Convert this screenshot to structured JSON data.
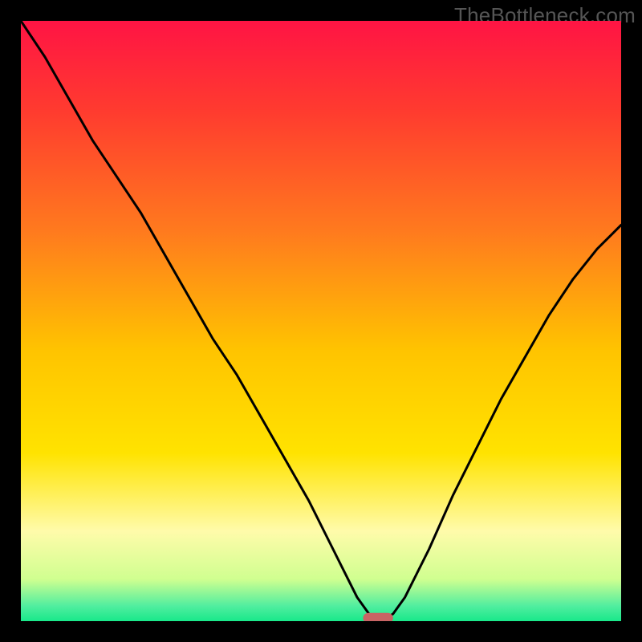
{
  "watermark": "TheBottleneck.com",
  "colors": {
    "frame": "#000000",
    "curve": "#000000",
    "marker": "#c86464",
    "gradient_stops": [
      {
        "offset": 0.0,
        "color": "#ff1444"
      },
      {
        "offset": 0.15,
        "color": "#ff3b2f"
      },
      {
        "offset": 0.35,
        "color": "#ff7a1e"
      },
      {
        "offset": 0.55,
        "color": "#ffc400"
      },
      {
        "offset": 0.72,
        "color": "#ffe300"
      },
      {
        "offset": 0.85,
        "color": "#fffbaa"
      },
      {
        "offset": 0.93,
        "color": "#d0ff90"
      },
      {
        "offset": 0.975,
        "color": "#50ee9f"
      },
      {
        "offset": 1.0,
        "color": "#18e88a"
      }
    ]
  },
  "chart_data": {
    "type": "line",
    "title": "",
    "xlabel": "",
    "ylabel": "",
    "xlim": [
      0,
      100
    ],
    "ylim": [
      0,
      100
    ],
    "grid": false,
    "x": [
      0,
      4,
      8,
      12,
      16,
      20,
      24,
      28,
      32,
      36,
      40,
      44,
      48,
      52,
      54,
      56,
      58,
      59,
      60,
      61,
      62,
      64,
      68,
      72,
      76,
      80,
      84,
      88,
      92,
      96,
      100
    ],
    "values": [
      100,
      94,
      87,
      80,
      74,
      68,
      61,
      54,
      47,
      41,
      34,
      27,
      20,
      12,
      8,
      4,
      1.2,
      0.6,
      0.5,
      0.6,
      1.2,
      4,
      12,
      21,
      29,
      37,
      44,
      51,
      57,
      62,
      66
    ],
    "marker": {
      "start_x": 57,
      "end_x": 62,
      "y": 0.5
    },
    "annotations": []
  }
}
